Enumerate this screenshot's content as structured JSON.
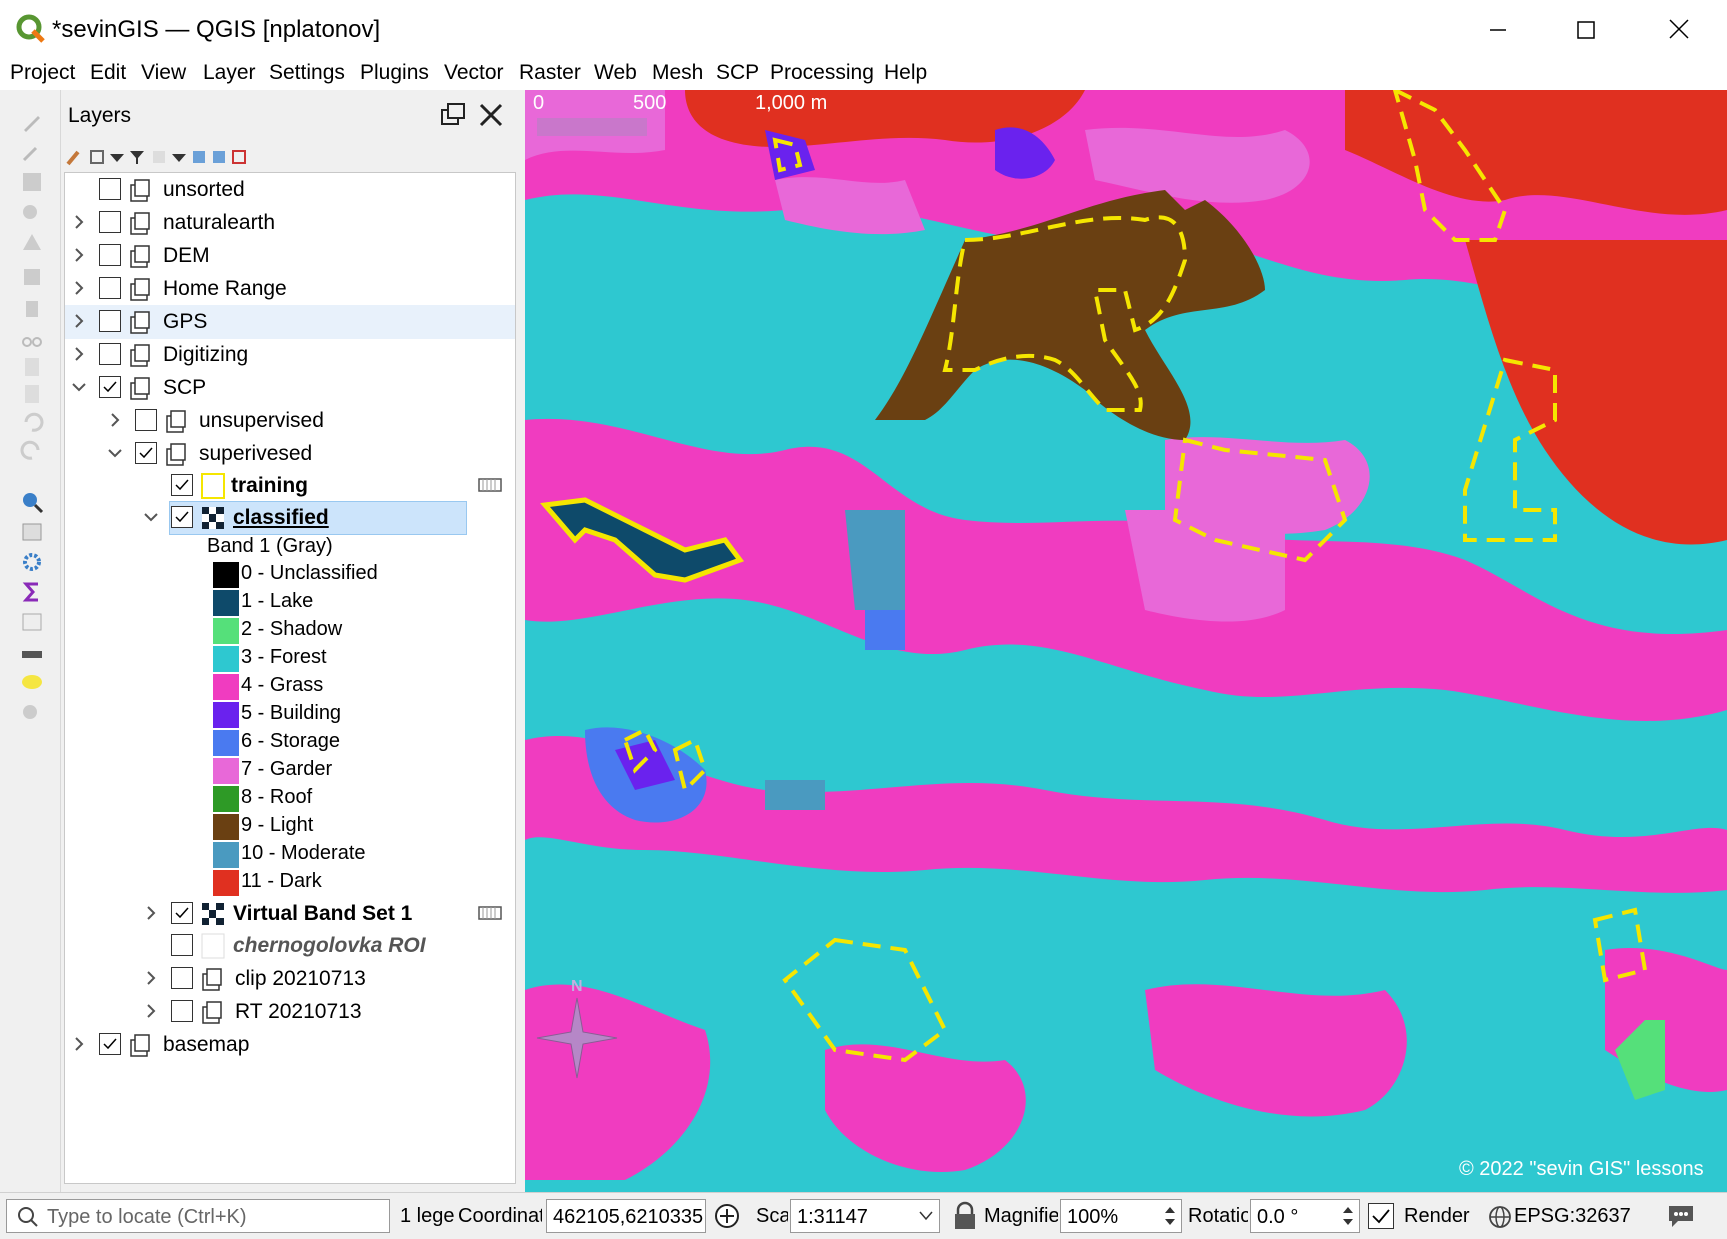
{
  "window": {
    "title": "*sevinGIS — QGIS [nplatonov]"
  },
  "menu": [
    "Project",
    "Edit",
    "View",
    "Layer",
    "Settings",
    "Plugins",
    "Vector",
    "Raster",
    "Web",
    "Mesh",
    "SCP",
    "Processing",
    "Help"
  ],
  "layers_panel": {
    "title": "Layers",
    "items": [
      {
        "label": "unsorted"
      },
      {
        "label": "naturalearth"
      },
      {
        "label": "DEM"
      },
      {
        "label": "Home Range"
      },
      {
        "label": "GPS"
      },
      {
        "label": "Digitizing"
      },
      {
        "label": "SCP"
      },
      {
        "label": "unsupervised"
      },
      {
        "label": "superivesed"
      },
      {
        "label": "training"
      },
      {
        "label": "classified"
      },
      {
        "label": "Virtual Band Set 1"
      },
      {
        "label": "chernogolovka ROI"
      },
      {
        "label": "clip 20210713"
      },
      {
        "label": "RT 20210713"
      },
      {
        "label": "basemap"
      }
    ],
    "band_label": "Band 1 (Gray)",
    "legend": [
      {
        "label": "0 - Unclassified",
        "color": "#000000"
      },
      {
        "label": "1 - Lake",
        "color": "#0e4a6a"
      },
      {
        "label": "2 - Shadow",
        "color": "#55e07a"
      },
      {
        "label": "3 - Forest",
        "color": "#2ec8d0"
      },
      {
        "label": "4 - Grass",
        "color": "#f03cc0"
      },
      {
        "label": "5 - Building",
        "color": "#6a22ee"
      },
      {
        "label": "6 - Storage",
        "color": "#4a7af0"
      },
      {
        "label": "7 - Garder",
        "color": "#e868d8"
      },
      {
        "label": "8 - Roof",
        "color": "#2e9a26"
      },
      {
        "label": "9 - Light",
        "color": "#6a4012"
      },
      {
        "label": "10 - Moderate",
        "color": "#4a9ac0"
      },
      {
        "label": "11 - Dark",
        "color": "#e03020"
      }
    ]
  },
  "map": {
    "scalebar": [
      "0",
      "500",
      "1,000 m"
    ],
    "north_label": "N",
    "copyright": "© 2022 \"sevin GIS\" lessons"
  },
  "status": {
    "locator_placeholder": "Type to locate (Ctrl+K)",
    "legend_text": "1 lege",
    "coord_label": "Coordinat",
    "coord_value": "462105,6210335",
    "scale_label": "Scal",
    "scale_value": "1:31147",
    "magnifier_label": "Magnifie",
    "magnifier_value": "100%",
    "rotation_label": "Rotatio",
    "rotation_value": "0.0 °",
    "render_label": "Render",
    "crs": "EPSG:32637"
  }
}
